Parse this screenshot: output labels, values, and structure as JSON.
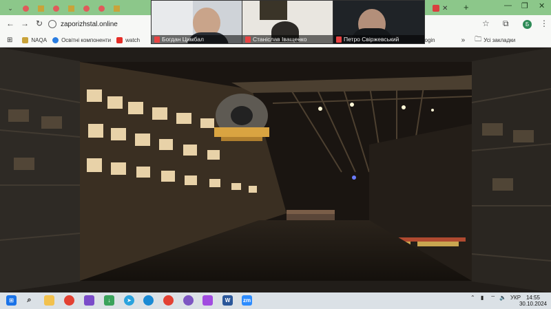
{
  "browser": {
    "url": "zaporizhstal.online",
    "profile_initial": "Б",
    "bookmarks": [
      {
        "label": "NAQA",
        "color": "#c9a33a"
      },
      {
        "label": "Освітні компоненти",
        "color": "#2a7de1"
      },
      {
        "label": "watch",
        "color": "#e52d27"
      }
    ],
    "bookmark_right": "pus - Login",
    "bookmarks_folder": "Усі закладки"
  },
  "meeting": {
    "participants": [
      {
        "name": "Богдан Цимбал"
      },
      {
        "name": "Станіслав Іващенко"
      },
      {
        "name": "Петро Свіржевський"
      }
    ]
  },
  "taskbar": {
    "language": "УКР",
    "time": "14:55",
    "date": "30.10.2024"
  },
  "icons": [
    "windows-start-icon",
    "search-icon",
    "file-explorer-icon",
    "chrome-icon",
    "unknown-app-icon",
    "download-icon",
    "telegram-icon",
    "edge-icon",
    "chrome-icon-2",
    "viber-icon",
    "app-icon",
    "word-icon",
    "zoom-icon"
  ],
  "colors": {
    "tab_bar": "#8cc78a",
    "taskbar": "#dbe1e6",
    "zoom": "#2d8cff"
  }
}
